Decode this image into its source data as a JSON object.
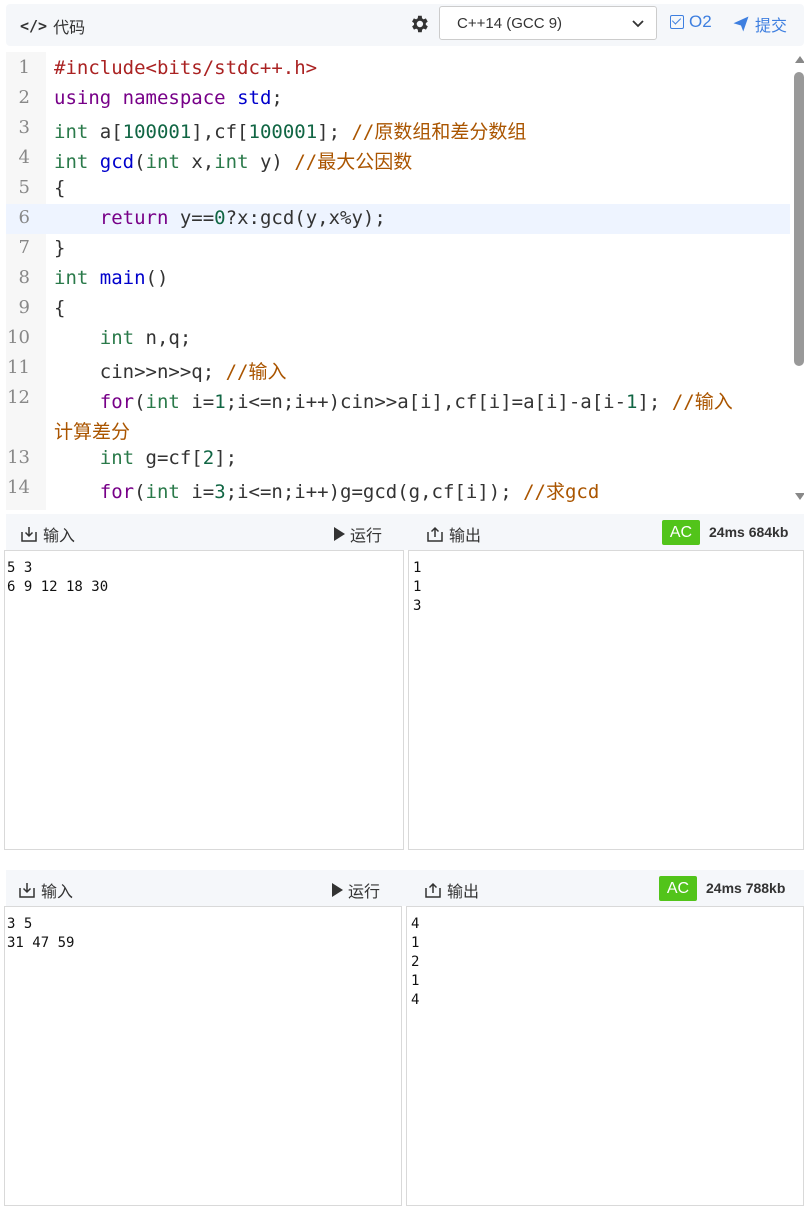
{
  "toolbar": {
    "code_label": "代码",
    "code_icon_text": "</>",
    "language": "C++14 (GCC 9)",
    "o2_label": "O2",
    "submit_label": "提交"
  },
  "editor": {
    "active_line": 6,
    "lines": [
      {
        "n": "1"
      },
      {
        "n": "2"
      },
      {
        "n": "3"
      },
      {
        "n": "4"
      },
      {
        "n": "5"
      },
      {
        "n": "6"
      },
      {
        "n": "7"
      },
      {
        "n": "8"
      },
      {
        "n": "9"
      },
      {
        "n": "10"
      },
      {
        "n": "11"
      },
      {
        "n": "12"
      },
      {
        "n": "13"
      },
      {
        "n": "14"
      }
    ],
    "code": {
      "l1": "#include<bits/stdc++.h>",
      "l2_a": "using",
      "l2_b": "namespace",
      "l2_c": "std",
      "l2_d": ";",
      "l3_a": "int",
      "l3_b": " a[",
      "l3_c": "100001",
      "l3_d": "],cf[",
      "l3_e": "100001",
      "l3_f": "]; ",
      "l3_g": "//原数组和差分数组",
      "l4_a": "int",
      "l4_b": "gcd",
      "l4_c": "(",
      "l4_d": "int",
      "l4_e": " x,",
      "l4_f": "int",
      "l4_g": " y) ",
      "l4_h": "//最大公因数",
      "l5": "{",
      "l6_a": "    ",
      "l6_b": "return",
      "l6_c": " y==",
      "l6_d": "0",
      "l6_e": "?x:gcd(y,x%y);",
      "l7": "}",
      "l8_a": "int",
      "l8_b": "main",
      "l8_c": "()",
      "l9": "{",
      "l10_a": "    ",
      "l10_b": "int",
      "l10_c": " n,q;",
      "l11_a": "    cin>>n>>q; ",
      "l11_b": "//输入",
      "l12_a": "    ",
      "l12_b": "for",
      "l12_c": "(",
      "l12_d": "int",
      "l12_e": " i=",
      "l12_f": "1",
      "l12_g": ";i<=n;i++)cin>>a[i],cf[i]=a[i]-a[i-",
      "l12_h": "1",
      "l12_i": "]; ",
      "l12_j": "//输入",
      "l12_wrap": "计算差分",
      "l13_a": "    ",
      "l13_b": "int",
      "l13_c": " g=cf[",
      "l13_d": "2",
      "l13_e": "];",
      "l14_a": "    ",
      "l14_b": "for",
      "l14_c": "(",
      "l14_d": "int",
      "l14_e": " i=",
      "l14_f": "3",
      "l14_g": ";i<=n;i++)g=gcd(g,cf[i]); ",
      "l14_h": "//求gcd"
    }
  },
  "io_panels": [
    {
      "input_label": "输入",
      "run_label": "运行",
      "output_label": "输出",
      "status": "AC",
      "stats": "24ms 684kb",
      "input_text": "5 3\n6 9 12 18 30",
      "output_text": "1\n1\n3"
    },
    {
      "input_label": "输入",
      "run_label": "运行",
      "output_label": "输出",
      "status": "AC",
      "stats": "24ms 788kb",
      "input_text": "3 5\n31 47 59",
      "output_text": "4\n1\n2\n1\n4"
    }
  ],
  "colors": {
    "accent": "#3e7fe0",
    "ac_green": "#52c41a"
  }
}
